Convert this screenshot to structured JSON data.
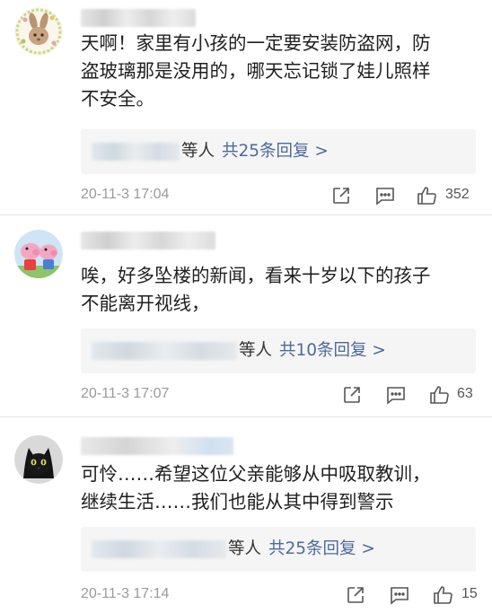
{
  "comments": [
    {
      "avatar": "bunny-wreath-avatar",
      "text_lines": [
        "天啊！家里有小孩的一定要安装防盗网，防",
        "盗玻璃那是没用的，哪天忘记锁了娃儿照样",
        "不安全。"
      ],
      "reply_suffix": "等人",
      "reply_count_label": "共25条回复 >",
      "time": "20-11-3 17:04",
      "likes": "352"
    },
    {
      "avatar": "peppa-pig-avatar",
      "text_lines": [
        "唉，好多坠楼的新闻，看来十岁以下的孩子",
        "不能离开视线，"
      ],
      "reply_suffix": "等人",
      "reply_count_label": "共10条回复 >",
      "time": "20-11-3 17:07",
      "likes": "63"
    },
    {
      "avatar": "black-cat-avatar",
      "text_lines": [
        "可怜……希望这位父亲能够从中吸取教训，",
        "继续生活……我们也能从其中得到警示"
      ],
      "reply_suffix": "等人",
      "reply_count_label": "共25条回复 >",
      "time": "20-11-3 17:14",
      "likes": "15"
    }
  ],
  "icons": {
    "share": "share-icon",
    "comment": "comment-icon",
    "like": "thumbs-up-icon"
  },
  "colors": {
    "link": "#4e6a9b",
    "meta": "#9a9a9a",
    "reply_bg": "#f5f5f5"
  }
}
